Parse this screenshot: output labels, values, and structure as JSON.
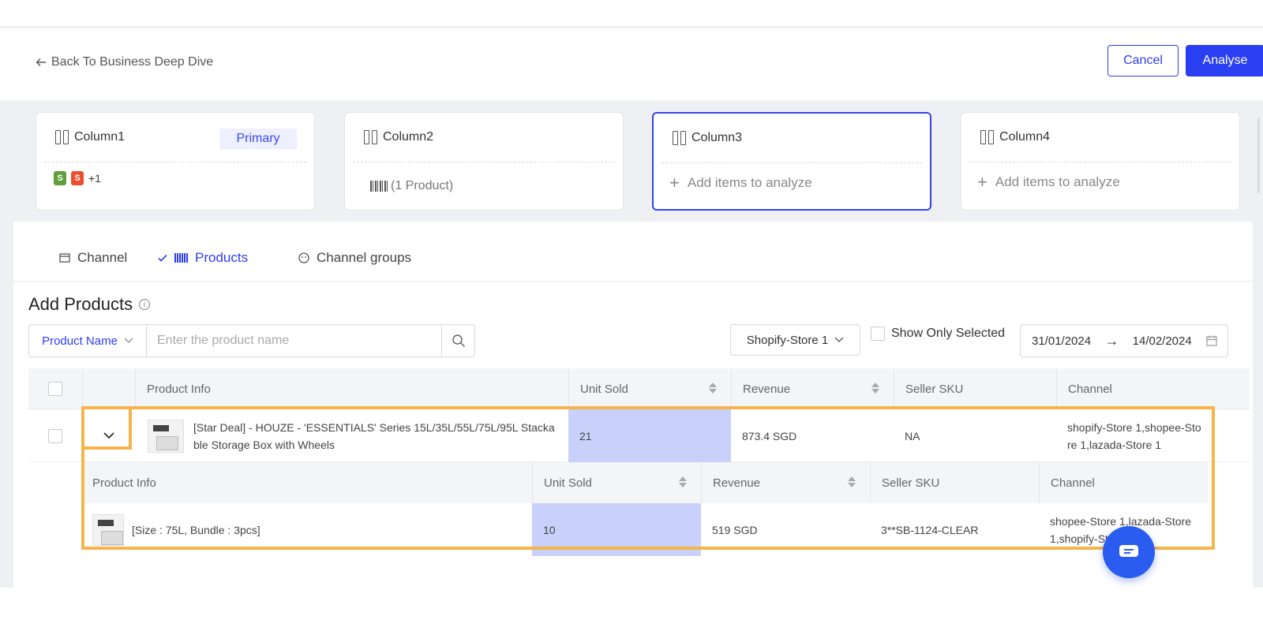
{
  "header": {
    "back_label": "Back To Business Deep Dive",
    "cancel_label": "Cancel",
    "analyse_label": "Analyse"
  },
  "columns": [
    {
      "label": "Column1",
      "tag": "Primary",
      "extra_count": "+1",
      "channel_icons": [
        "shopify-icon",
        "shopee-icon"
      ]
    },
    {
      "label": "Column2",
      "summary": "(1 Product)"
    },
    {
      "label": "Column3",
      "add_label": "Add items to analyze"
    },
    {
      "label": "Column4",
      "add_label": "Add items to analyze"
    }
  ],
  "tabs": [
    {
      "label": "Channel",
      "icon": "store-icon"
    },
    {
      "label": "Products",
      "icon": "barcode-icon",
      "active": true
    },
    {
      "label": "Channel groups",
      "icon": "group-icon"
    }
  ],
  "panel": {
    "title": "Add Products"
  },
  "search": {
    "field_label": "Product Name",
    "placeholder": "Enter the product name"
  },
  "filters": {
    "store": "Shopify-Store 1",
    "show_only_selected": "Show Only Selected",
    "date_start": "31/01/2024",
    "date_arrow": "→",
    "date_end": "14/02/2024"
  },
  "table": {
    "headers": [
      "Product Info",
      "Unit Sold",
      "Revenue",
      "Seller SKU",
      "Channel"
    ],
    "row": {
      "name_line1": "[Star Deal] - HOUZE - 'ESSENTIALS' Series 15L/35L/55L/75L/95L Stacka",
      "name_line2": "ble Storage Box with Wheels",
      "unit_sold": "21",
      "revenue": "873.4 SGD",
      "sku": "NA",
      "channel_line1": "shopify-Store 1,shopee-Sto",
      "channel_line2": "re 1,lazada-Store 1"
    },
    "sub_headers": [
      "Product Info",
      "Unit Sold",
      "Revenue",
      "Seller SKU",
      "Channel"
    ],
    "sub_row": {
      "variant": "[Size : 75L, Bundle : 3pcs]",
      "unit_sold": "10",
      "revenue": "519 SGD",
      "sku": "3**SB-1124-CLEAR",
      "channel_line1": "shopee-Store 1,lazada-Store",
      "channel_line2": "1,shopify-St"
    }
  },
  "colors": {
    "primary": "#2a3ff1",
    "highlight": "#c9d1fb",
    "outline": "#f5b54b"
  }
}
